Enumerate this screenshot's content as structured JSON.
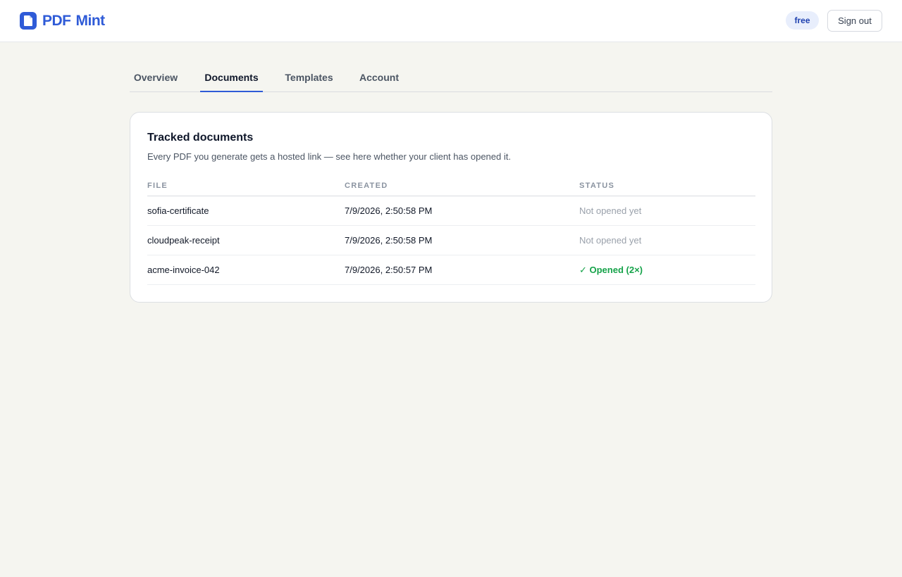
{
  "app": {
    "brand_word1": "PDF",
    "brand_word2": "Mint",
    "plan": "free",
    "sign_out": "Sign out"
  },
  "tabs": [
    {
      "label": "Overview",
      "active": false
    },
    {
      "label": "Documents",
      "active": true
    },
    {
      "label": "Templates",
      "active": false
    },
    {
      "label": "Account",
      "active": false
    }
  ],
  "card": {
    "title": "Tracked documents",
    "subtitle": "Every PDF you generate gets a hosted link — see here whether your client has opened it.",
    "columns": [
      "FILE",
      "CREATED",
      "STATUS"
    ],
    "rows": [
      {
        "file": "sofia-certificate",
        "created": "7/9/2026, 2:50:58 PM",
        "status": "Not opened yet",
        "opened": false
      },
      {
        "file": "cloudpeak-receipt",
        "created": "7/9/2026, 2:50:58 PM",
        "status": "Not opened yet",
        "opened": false
      },
      {
        "file": "acme-invoice-042",
        "created": "7/9/2026, 2:50:57 PM",
        "status": "✓ Opened (2×)",
        "opened": true
      }
    ]
  },
  "colors": {
    "brand": "#2f5bd7",
    "opened": "#16a34a",
    "muted": "#9aa1ab",
    "page_bg": "#f5f5f0"
  },
  "icons": {
    "logo": "document-icon"
  }
}
